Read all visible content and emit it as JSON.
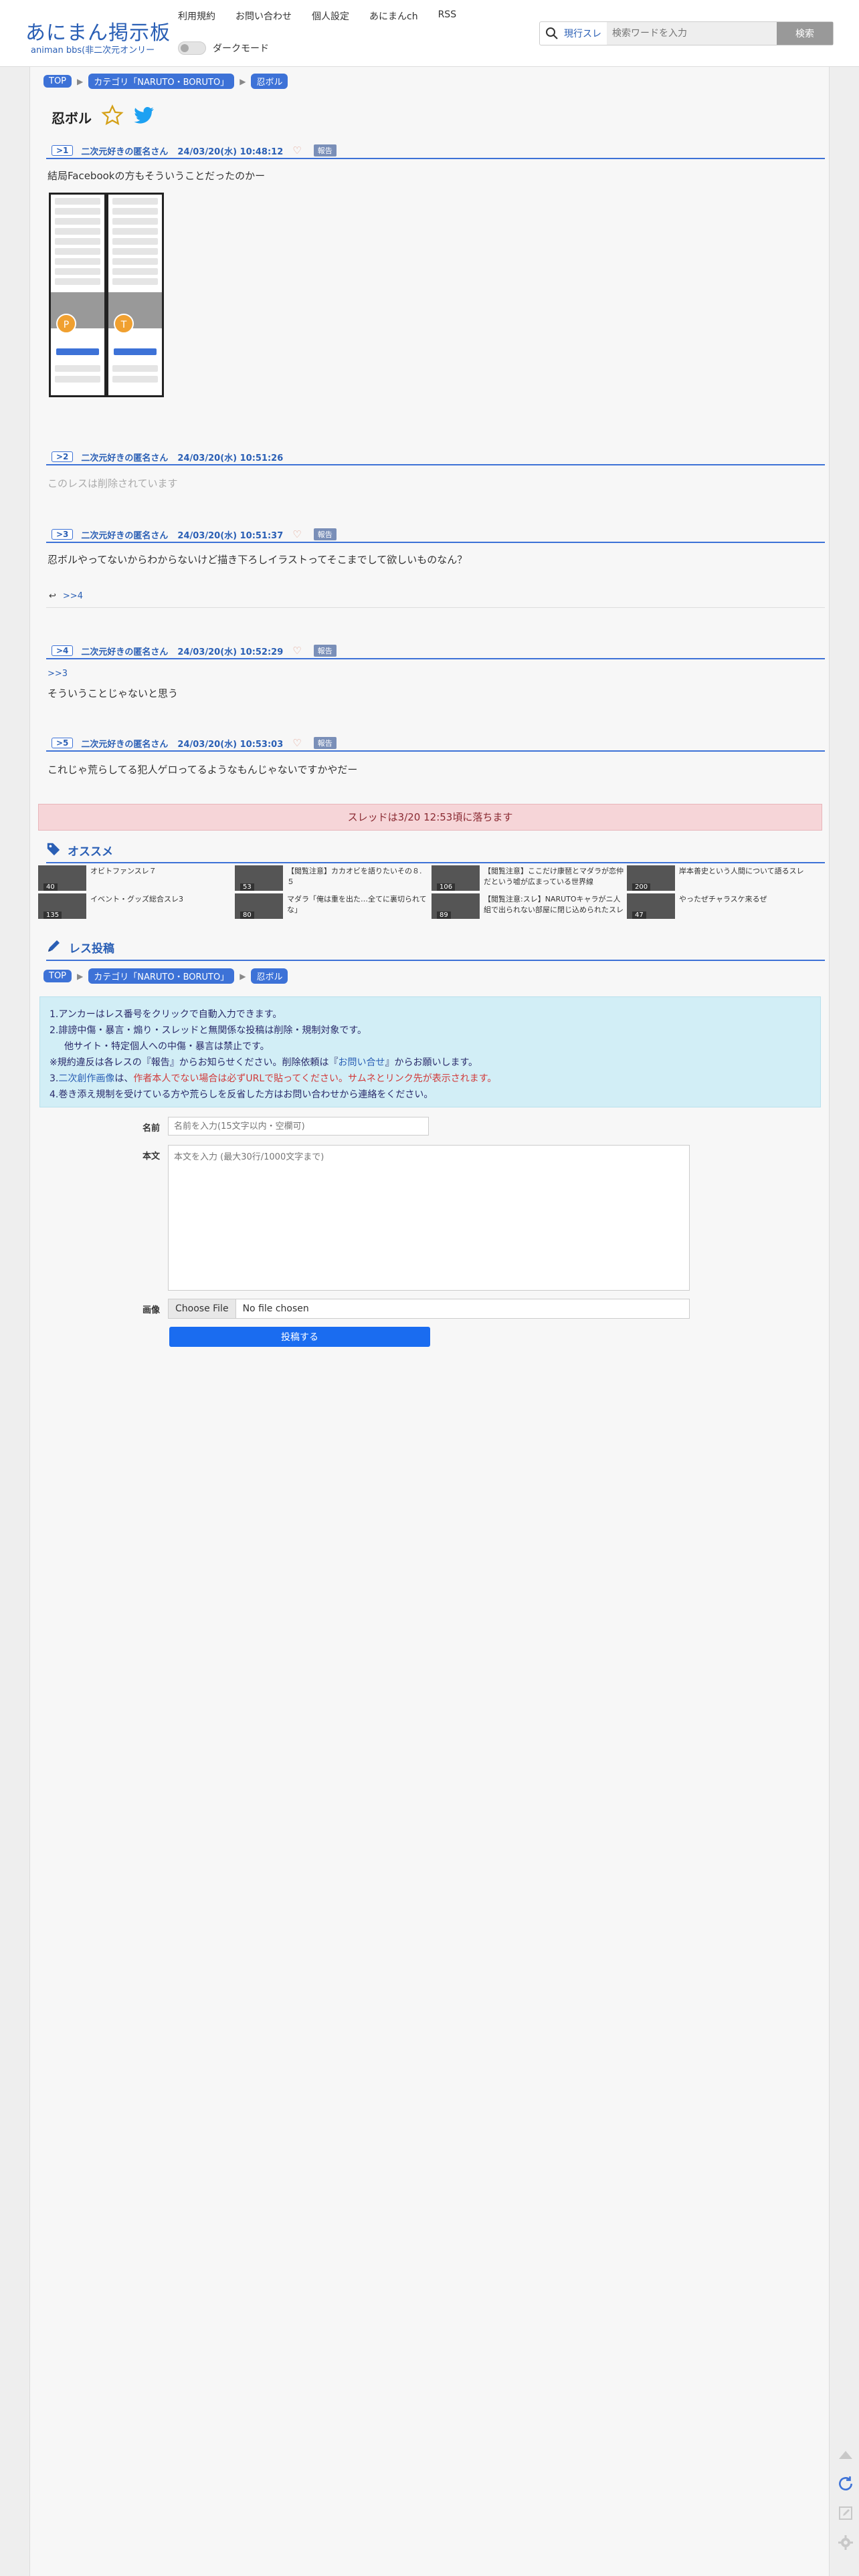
{
  "header": {
    "logo_title": "あにまん掲示板",
    "logo_sub": "animan bbs(非二次元オンリー",
    "nav": [
      "利用規約",
      "お問い合わせ",
      "個人設定",
      "あにまんch",
      "RSS"
    ],
    "dark_mode_label": "ダークモード",
    "search_mode": "現行スレ",
    "search_placeholder": "検索ワードを入力",
    "search_button": "検索"
  },
  "breadcrumb": {
    "top": "TOP",
    "category": "カテゴリ「NARUTO・BORUTO」",
    "thread": "忍ボル"
  },
  "thread": {
    "title": "忍ボル"
  },
  "posts": [
    {
      "no": ">1",
      "name": "二次元好きの匿名さん",
      "date": "24/03/20(水) 10:48:12",
      "report": "報告",
      "body": "結局Facebookの方もそういうことだったのかー"
    },
    {
      "no": ">2",
      "name": "二次元好きの匿名さん",
      "date": "24/03/20(水) 10:51:26",
      "body": "このレスは削除されています"
    },
    {
      "no": ">3",
      "name": "二次元好きの匿名さん",
      "date": "24/03/20(水) 10:51:37",
      "report": "報告",
      "body": "忍ボルやってないからわからないけど描き下ろしイラストってそこまでして欲しいものなん？",
      "reply": ">>4"
    },
    {
      "no": ">4",
      "name": "二次元好きの匿名さん",
      "date": "24/03/20(水) 10:52:29",
      "report": "報告",
      "anchor": ">>3",
      "body": "そういうことじゃないと思う"
    },
    {
      "no": ">5",
      "name": "二次元好きの匿名さん",
      "date": "24/03/20(水) 10:53:03",
      "report": "報告",
      "body": "これじゃ荒らしてる犯人ゲロってるようなもんじゃないですかやだー"
    }
  ],
  "screenshot_avatars": [
    "P",
    "T"
  ],
  "drop_notice": "スレッドは3/20 12:53頃に落ちます",
  "recommend": {
    "heading": "オススメ",
    "items": [
      {
        "title": "オビトファンスレ７",
        "count": "40"
      },
      {
        "title": "【閲覧注意】カカオビを語りたいその８.５",
        "count": "53"
      },
      {
        "title": "【閲覧注意】ここだけ康琶とマダラが恋仲だという嘘が広まっている世界線",
        "count": "106"
      },
      {
        "title": "岸本善史という人間について語るスレ",
        "count": "200"
      },
      {
        "title": "イベント・グッズ総合スレ3",
        "count": "135"
      },
      {
        "title": "マダラ「俺は重を出た…全てに裏切られてな」",
        "count": "80"
      },
      {
        "title": "【閲覧注意:スレ】NARUTOキャラがニ人組で出られない部屋に閉じ込められたスレ",
        "count": "89"
      },
      {
        "title": "やったぜチャラスケ来るぜ",
        "count": "47"
      }
    ]
  },
  "reply_form": {
    "heading": "レス投稿",
    "notice": [
      "1.アンカーはレス番号をクリックで自動入力できます。",
      "2.誹謗中傷・暴言・煽り・スレッドと無関係な投稿は削除・規制対象です。",
      "他サイト・特定個人への中傷・暴言は禁止です。",
      "※規約違反は各レスの『報告』からお知らせください。削除依頼は『",
      "お問い合せ",
      "』からお願いします。",
      "3.",
      "二次創作画像",
      "は、",
      "作者本人でない場合は必ずURLで貼ってください。サムネとリンク先が表示されます。",
      "4.巻き添え規制を受けている方や荒らしを反省した方はお問い合わせから連絡をください。"
    ],
    "name_label": "名前",
    "name_placeholder": "名前を入力(15文字以内・空欄可)",
    "body_label": "本文",
    "body_placeholder": "本文を入力 (最大30行/1000文字まで)",
    "image_label": "画像",
    "file_button": "Choose File",
    "file_status": "No file chosen",
    "submit": "投稿する"
  },
  "colors": {
    "accent": "#3d72d7",
    "notice_bg": "#d2eef6",
    "drop_bg": "#f6d5d8",
    "submit": "#1a6cf0"
  }
}
